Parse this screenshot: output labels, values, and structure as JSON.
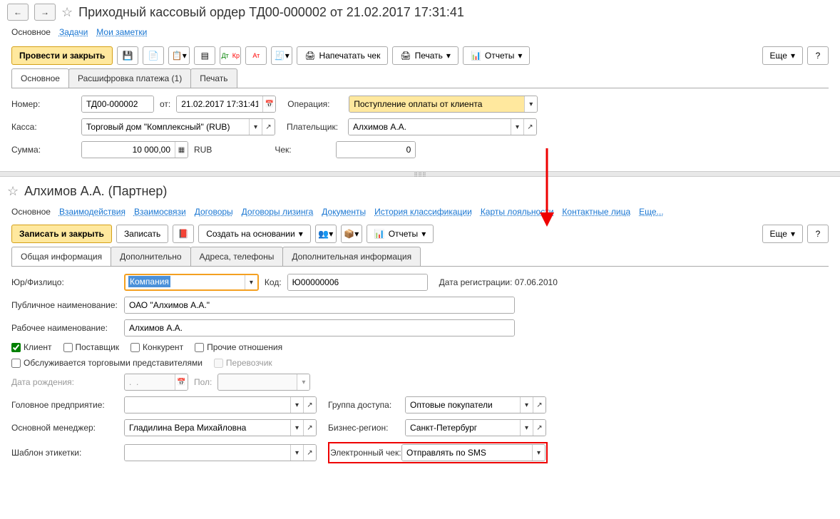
{
  "pane1": {
    "title": "Приходный кассовый ордер ТД00-000002 от 21.02.2017 17:31:41",
    "linkbar": {
      "main": "Основное",
      "tasks": "Задачи",
      "notes": "Мои заметки"
    },
    "toolbar": {
      "post_close": "Провести и закрыть",
      "print_check": "Напечатать чек",
      "print": "Печать",
      "reports": "Отчеты",
      "more": "Еще"
    },
    "tabs": [
      "Основное",
      "Расшифровка платежа (1)",
      "Печать"
    ],
    "fields": {
      "number_label": "Номер:",
      "number": "ТД00-000002",
      "date_label": "от:",
      "date": "21.02.2017 17:31:41",
      "operation_label": "Операция:",
      "operation": "Поступление оплаты от клиента",
      "cashbox_label": "Касса:",
      "cashbox": "Торговый дом \"Комплексный\" (RUB)",
      "payer_label": "Плательщик:",
      "payer": "Алхимов А.А.",
      "sum_label": "Сумма:",
      "sum": "10 000,00",
      "currency": "RUB",
      "check_label": "Чек:",
      "check": "0"
    }
  },
  "pane2": {
    "title": "Алхимов А.А. (Партнер)",
    "links": [
      "Основное",
      "Взаимодействия",
      "Взаимосвязи",
      "Договоры",
      "Договоры лизинга",
      "Документы",
      "История классификации",
      "Карты лояльности",
      "Контактные лица",
      "Еще..."
    ],
    "toolbar": {
      "save_close": "Записать и закрыть",
      "save": "Записать",
      "create_based": "Создать на основании",
      "reports": "Отчеты",
      "more": "Еще"
    },
    "tabs": [
      "Общая информация",
      "Дополнительно",
      "Адреса, телефоны",
      "Дополнительная информация"
    ],
    "fields": {
      "legal_label": "Юр/Физлицо:",
      "legal": "Компания",
      "code_label": "Код:",
      "code": "Ю00000006",
      "reg_date_label": "Дата регистрации:",
      "reg_date": "07.06.2010",
      "pub_name_label": "Публичное наименование:",
      "pub_name": "ОАО \"Алхимов А.А.\"",
      "work_name_label": "Рабочее наименование:",
      "work_name": "Алхимов А.А.",
      "cb_client": "Клиент",
      "cb_supplier": "Поставщик",
      "cb_competitor": "Конкурент",
      "cb_other": "Прочие отношения",
      "cb_serviced": "Обслуживается торговыми представителями",
      "cb_carrier": "Перевозчик",
      "birth_label": "Дата рождения:",
      "birth": ".  .",
      "gender_label": "Пол:",
      "head_label": "Головное предприятие:",
      "access_label": "Группа доступа:",
      "access": "Оптовые покупатели",
      "manager_label": "Основной менеджер:",
      "manager": "Гладилина Вера Михайловна",
      "region_label": "Бизнес-регион:",
      "region": "Санкт-Петербург",
      "template_label": "Шаблон этикетки:",
      "echeck_label": "Электронный чек:",
      "echeck": "Отправлять по SMS"
    }
  }
}
